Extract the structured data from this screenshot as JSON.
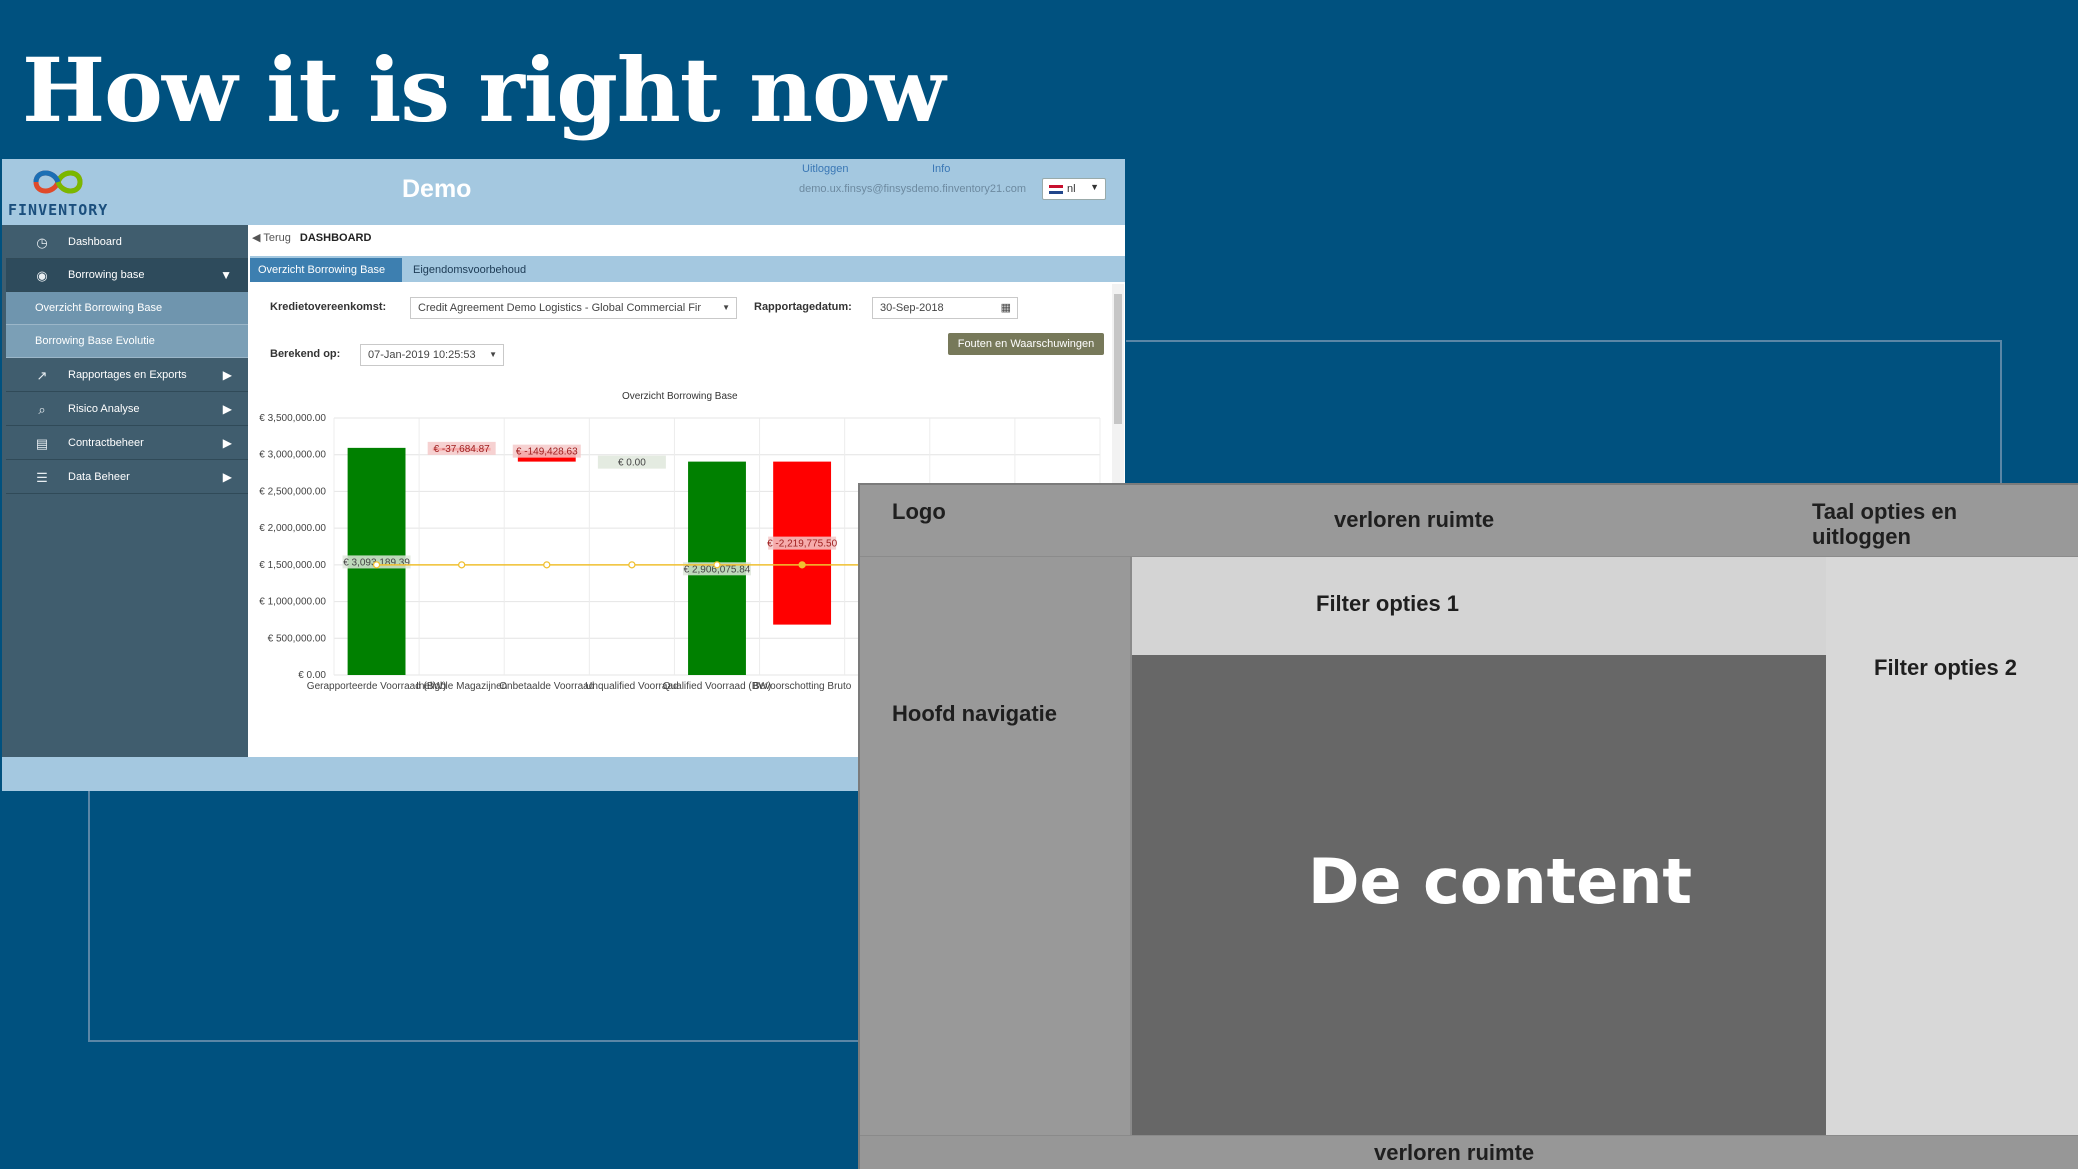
{
  "slide": {
    "title": "How it is right now"
  },
  "app": {
    "logo_text": "FINVENTORY",
    "title": "Demo",
    "header": {
      "logout_link": "Uitloggen",
      "info_link": "Info",
      "user_email": "demo.ux.finsys@finsysdemo.finventory21.com",
      "language": "nl"
    },
    "sidebar": {
      "items": [
        {
          "label": "Dashboard",
          "icon": "dashboard-icon"
        },
        {
          "label": "Borrowing base",
          "icon": "eye-icon",
          "expanded": true
        },
        {
          "label": "Overzicht Borrowing Base",
          "sub": true,
          "selected": true
        },
        {
          "label": "Borrowing Base Evolutie",
          "sub": true
        },
        {
          "label": "Rapportages en Exports",
          "icon": "chart-up-icon"
        },
        {
          "label": "Risico Analyse",
          "icon": "magnifier-icon"
        },
        {
          "label": "Contractbeheer",
          "icon": "contract-icon"
        },
        {
          "label": "Data Beheer",
          "icon": "database-icon"
        }
      ]
    },
    "breadcrumb": {
      "back": "Terug",
      "current": "DASHBOARD"
    },
    "tabs": [
      "Overzicht Borrowing Base",
      "Eigendomsvoorbehoud"
    ],
    "filters": {
      "agreement_label": "Kredietovereenkomst:",
      "agreement_value": "Credit Agreement Demo Logistics - Global Commercial Fir",
      "report_date_label": "Rapportagedatum:",
      "report_date_value": "30-Sep-2018",
      "calculated_label": "Berekend op:",
      "calculated_value": "07-Jan-2019 10:25:53",
      "errors_button": "Fouten en Waarschuwingen"
    },
    "colors": {
      "header": "#a4c8e0",
      "sidebar": "#405d6e",
      "positive": "#008000",
      "negative": "#ff0000",
      "line": "#f0c030"
    }
  },
  "chart_data": {
    "type": "bar",
    "title": "Overzicht Borrowing Base",
    "categories": [
      "Gerapporteerde Voorraad (BW)",
      "Ineligble Magazijnen",
      "Onbetaalde Voorraad",
      "Unqualified Voorraad",
      "Qualified Voorraad (BW)",
      "Bevoorschotting Bruto"
    ],
    "values": [
      3093189.39,
      -37684.87,
      -149428.63,
      0.0,
      2906075.84,
      -2219775.5
    ],
    "value_labels": [
      "€ 3,093,189.39",
      "€ -37,684.87",
      "€ -149,428.63",
      "€ 0.00",
      "€ 2,906,075.84",
      "€ -2,219,775.50"
    ],
    "y_ticks": [
      "€ 3,500,000.00",
      "€ 3,000,000.00",
      "€ 2,500,000.00",
      "€ 2,000,000.00",
      "€ 1,500,000.00",
      "€ 1,000,000.00",
      "€ 500,000.00",
      "€ 0.00"
    ],
    "ylim": [
      0,
      3500000
    ],
    "grid": true
  },
  "wireframe": {
    "logo": "Logo",
    "top_waste": "verloren ruimte",
    "language_logout": "Taal opties en uitloggen",
    "main_nav": "Hoofd navigatie",
    "filter1": "Filter opties 1",
    "filter2": "Filter opties 2",
    "content": "De content",
    "bottom_waste": "verloren ruimte"
  }
}
